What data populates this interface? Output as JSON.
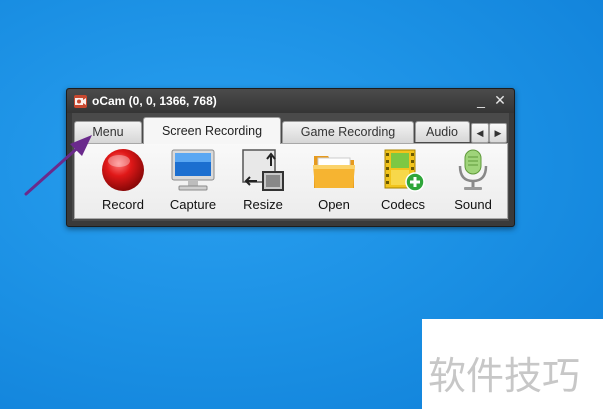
{
  "window": {
    "title": "oCam (0, 0, 1366, 768)",
    "minimize_glyph": "_",
    "close_glyph": "✕"
  },
  "tabs": {
    "menu": "Menu",
    "screen_recording": "Screen Recording",
    "game_recording": "Game Recording",
    "audio": "Audio",
    "scroll_left": "◀",
    "scroll_right": "▶"
  },
  "tools": [
    {
      "label": "Record",
      "icon": "record-icon"
    },
    {
      "label": "Capture",
      "icon": "monitor-icon"
    },
    {
      "label": "Resize",
      "icon": "resize-icon"
    },
    {
      "label": "Open",
      "icon": "folder-icon"
    },
    {
      "label": "Codecs",
      "icon": "film-plus-icon"
    },
    {
      "label": "Sound",
      "icon": "microphone-icon"
    }
  ],
  "watermark": {
    "text": "软件技巧"
  },
  "colors": {
    "desktop": "#1a8fe3",
    "arrow": "#6a2a8c",
    "record": "#d81a1a"
  }
}
